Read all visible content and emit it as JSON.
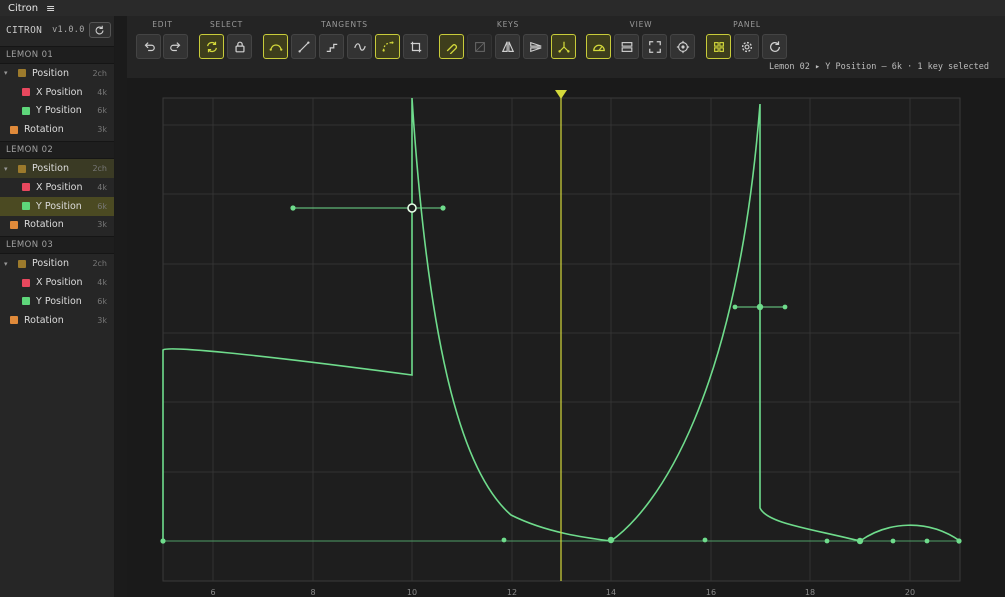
{
  "app": {
    "title": "Citron",
    "menu_icon": "hamburger-icon"
  },
  "sidebar": {
    "brand": "CITRON",
    "version": "v1.0.0",
    "refresh_icon": "refresh-icon",
    "groups": [
      {
        "name": "LEMON 01",
        "position_label": "Position",
        "position_ch": "2ch",
        "x_label": "X Position",
        "x_ch": "4k",
        "y_label": "Y Position",
        "y_ch": "6k",
        "rot_label": "Rotation",
        "rot_ch": "3k"
      },
      {
        "name": "LEMON 02",
        "position_label": "Position",
        "position_ch": "2ch",
        "x_label": "X Position",
        "x_ch": "4k",
        "y_label": "Y Position",
        "y_ch": "6k",
        "rot_label": "Rotation",
        "rot_ch": "3k"
      },
      {
        "name": "LEMON 03",
        "position_label": "Position",
        "position_ch": "2ch",
        "x_label": "X Position",
        "x_ch": "4k",
        "y_label": "Y Position",
        "y_ch": "6k",
        "rot_label": "Rotation",
        "rot_ch": "3k"
      }
    ]
  },
  "toolbar": {
    "groups": {
      "edit": "EDIT",
      "select": "SELECT",
      "tangents": "TANGENTS",
      "keys": "KEYS",
      "view": "VIEW",
      "panel": "PANEL"
    },
    "status": "Lemon 02 ▸ Y Position — 6k · 1 key selected"
  },
  "colors": {
    "accent": "#d4d93b",
    "curve": "#6fdc8c",
    "position": "#9c7a2c",
    "x_channel": "#e8485e",
    "y_channel": "#5ed67a",
    "rotation": "#e08a3a"
  },
  "chart_data": {
    "type": "line",
    "x_ticks": [
      "6",
      "8",
      "10",
      "12",
      "14",
      "16",
      "18",
      "20"
    ],
    "playhead_frame": 13
  }
}
